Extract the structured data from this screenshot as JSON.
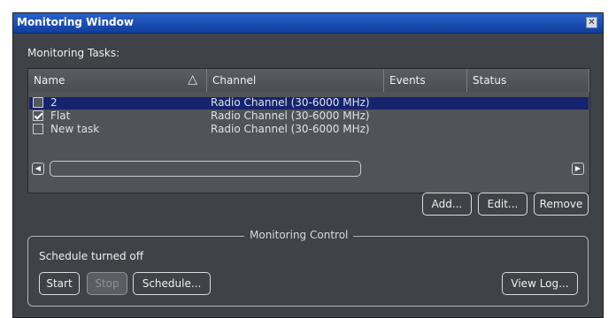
{
  "window": {
    "title": "Monitoring Window",
    "close": "✕"
  },
  "tasks_label": "Monitoring Tasks:",
  "table": {
    "columns": [
      "Name",
      "Channel",
      "Events",
      "Status"
    ],
    "sort_glyph": "△",
    "rows": [
      {
        "name": "2",
        "channel": "Radio Channel (30-6000 MHz)",
        "checked": false,
        "selected": true
      },
      {
        "name": "Flat",
        "channel": "Radio Channel (30-6000 MHz)",
        "checked": true,
        "selected": false
      },
      {
        "name": "New task",
        "channel": "Radio Channel (30-6000 MHz)",
        "checked": false,
        "selected": false
      }
    ],
    "scroll_left": "◀",
    "scroll_right": "▶"
  },
  "task_buttons": {
    "add": "Add...",
    "edit": "Edit...",
    "remove": "Remove"
  },
  "control": {
    "title": "Monitoring Control",
    "status": "Schedule turned off",
    "start": "Start",
    "stop": "Stop",
    "schedule": "Schedule...",
    "view_log": "View Log..."
  }
}
